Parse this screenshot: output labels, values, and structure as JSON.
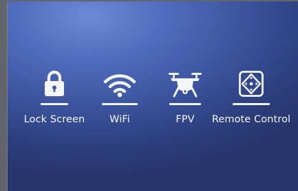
{
  "menu": {
    "items": [
      {
        "label": "Lock Screen",
        "icon": "lock-icon"
      },
      {
        "label": "WiFi",
        "icon": "wifi-icon"
      },
      {
        "label": "FPV",
        "icon": "drone-icon"
      },
      {
        "label": "Remote Control",
        "icon": "remote-control-icon"
      }
    ]
  },
  "colors": {
    "background_top": "#6c8ad6",
    "background_bottom": "#26366c",
    "foreground": "#f4f6fa",
    "bezel": "#62666c"
  }
}
